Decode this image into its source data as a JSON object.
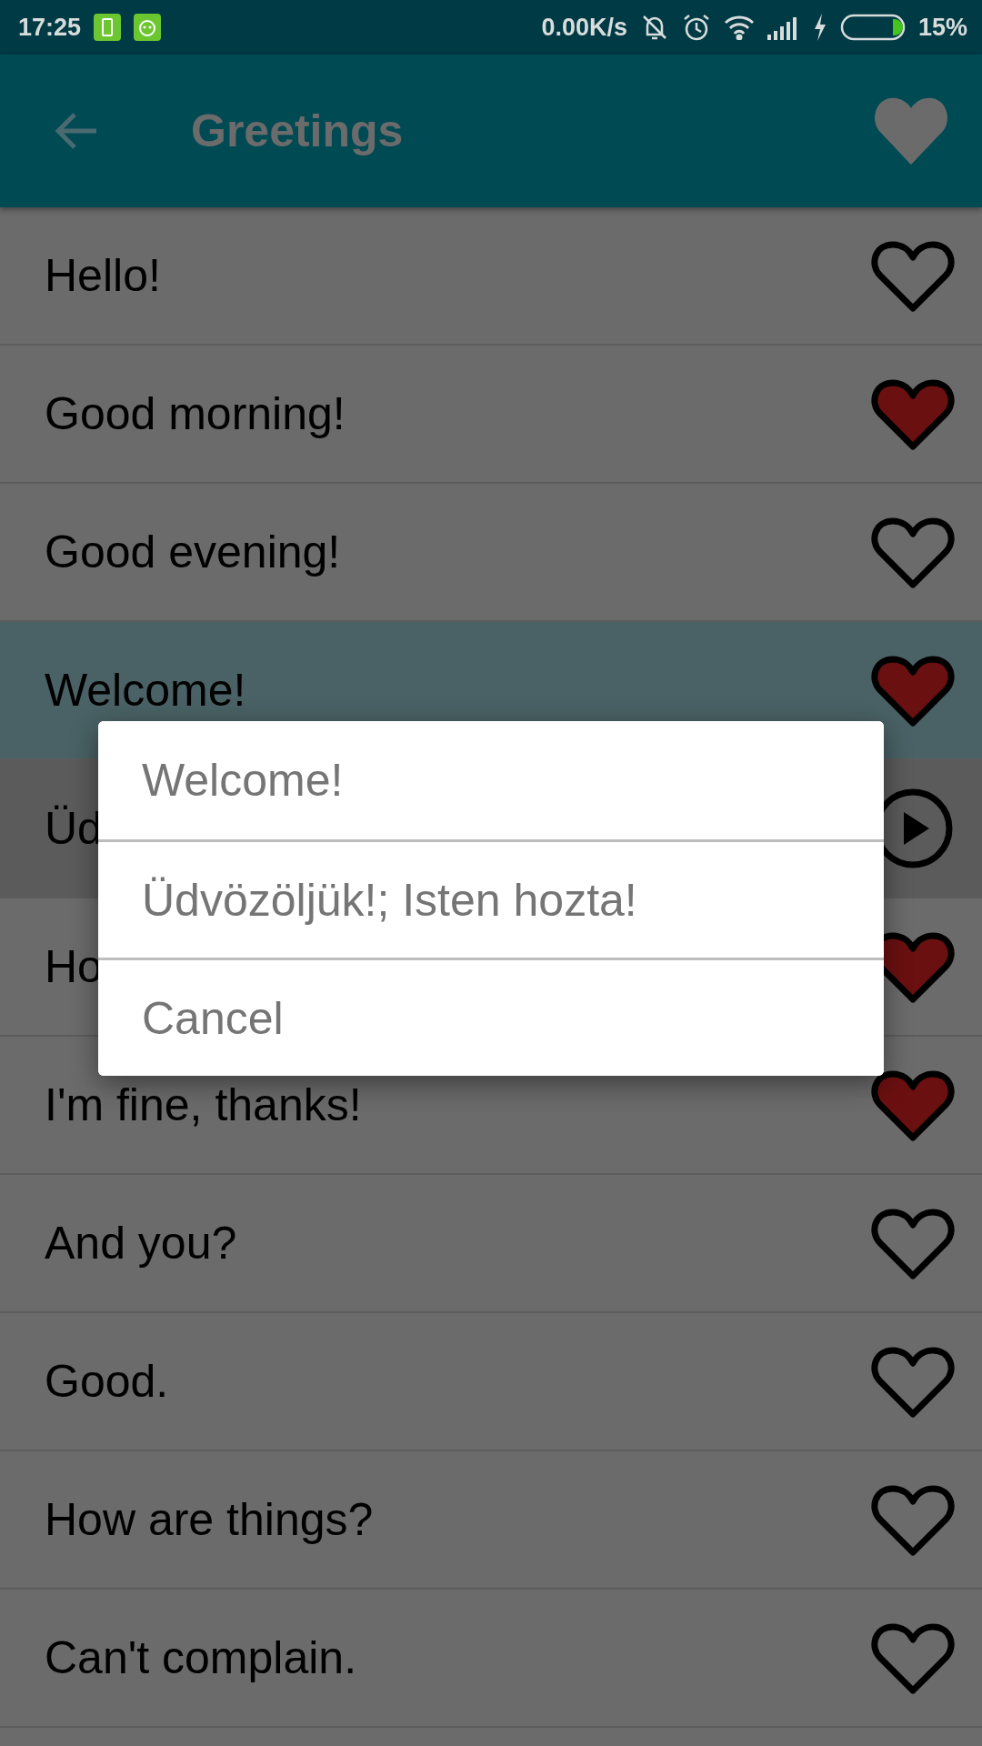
{
  "status_bar": {
    "time": "17:25",
    "network_speed": "0.00K/s",
    "battery": "15%"
  },
  "app_bar": {
    "title": "Greetings",
    "favorite": true
  },
  "rows": [
    {
      "text": "Hello!",
      "kind": "favorite",
      "favorite": false,
      "selected": false
    },
    {
      "text": "Good morning!",
      "kind": "favorite",
      "favorite": true,
      "selected": false
    },
    {
      "text": "Good evening!",
      "kind": "favorite",
      "favorite": false,
      "selected": false
    },
    {
      "text": "Welcome!",
      "kind": "favorite",
      "favorite": true,
      "selected": true
    },
    {
      "text": "Üd",
      "kind": "play",
      "selected": false
    },
    {
      "text": "Ho",
      "kind": "favorite",
      "favorite": true,
      "selected": false
    },
    {
      "text": "I'm fine, thanks!",
      "kind": "favorite",
      "favorite": true,
      "selected": false
    },
    {
      "text": "And you?",
      "kind": "favorite",
      "favorite": false,
      "selected": false
    },
    {
      "text": "Good.",
      "kind": "favorite",
      "favorite": false,
      "selected": false
    },
    {
      "text": "How are things?",
      "kind": "favorite",
      "favorite": false,
      "selected": false
    },
    {
      "text": "Can't complain.",
      "kind": "favorite",
      "favorite": false,
      "selected": false
    }
  ],
  "dialog": {
    "items": [
      "Welcome!",
      "Üdvözöljük!; Isten hozta!",
      "Cancel"
    ]
  }
}
